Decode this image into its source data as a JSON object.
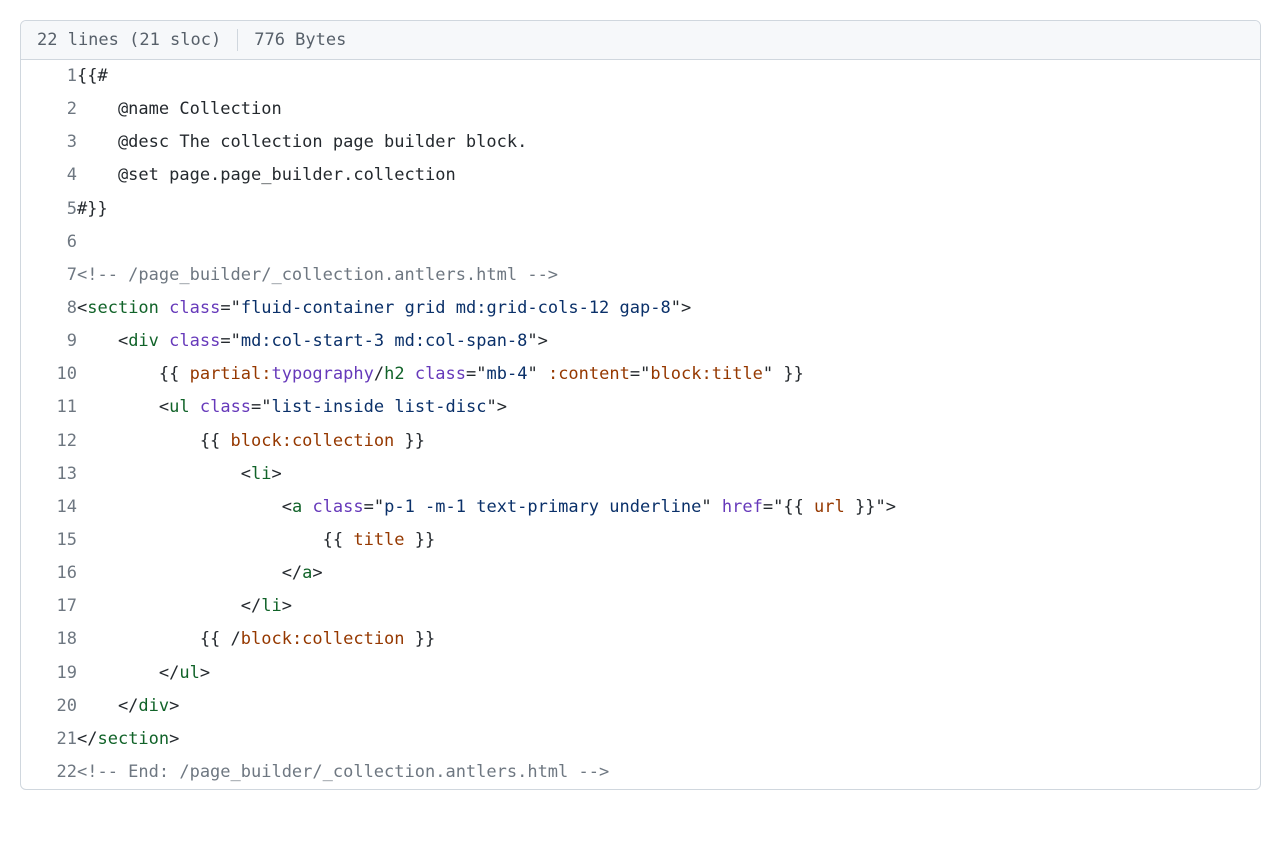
{
  "header": {
    "lines_sloc": "22 lines (21 sloc)",
    "bytes": "776 Bytes"
  },
  "lines": [
    {
      "n": "1",
      "tokens": [
        {
          "t": "{{#",
          "c": "p"
        }
      ]
    },
    {
      "n": "2",
      "tokens": [
        {
          "t": "    @name Collection",
          "c": "p"
        }
      ]
    },
    {
      "n": "3",
      "tokens": [
        {
          "t": "    @desc The collection page builder block.",
          "c": "p"
        }
      ]
    },
    {
      "n": "4",
      "tokens": [
        {
          "t": "    @set page.page_builder.collection",
          "c": "p"
        }
      ]
    },
    {
      "n": "5",
      "tokens": [
        {
          "t": "#}}",
          "c": "p"
        }
      ]
    },
    {
      "n": "6",
      "tokens": [
        {
          "t": "",
          "c": "p"
        }
      ]
    },
    {
      "n": "7",
      "tokens": [
        {
          "t": "<!-- /page_builder/_collection.antlers.html -->",
          "c": "c"
        }
      ]
    },
    {
      "n": "8",
      "tokens": [
        {
          "t": "<",
          "c": "p"
        },
        {
          "t": "section",
          "c": "nt"
        },
        {
          "t": " ",
          "c": "p"
        },
        {
          "t": "class",
          "c": "na"
        },
        {
          "t": "=\"",
          "c": "p"
        },
        {
          "t": "fluid-container grid md:grid-cols-12 gap-8",
          "c": "s"
        },
        {
          "t": "\">",
          "c": "p"
        }
      ]
    },
    {
      "n": "9",
      "tokens": [
        {
          "t": "    <",
          "c": "p"
        },
        {
          "t": "div",
          "c": "nt"
        },
        {
          "t": " ",
          "c": "p"
        },
        {
          "t": "class",
          "c": "na"
        },
        {
          "t": "=\"",
          "c": "p"
        },
        {
          "t": "md:col-start-3 md:col-span-8",
          "c": "s"
        },
        {
          "t": "\">",
          "c": "p"
        }
      ]
    },
    {
      "n": "10",
      "tokens": [
        {
          "t": "        {{ ",
          "c": "p"
        },
        {
          "t": "partial:",
          "c": "kw"
        },
        {
          "t": "typography",
          "c": "na"
        },
        {
          "t": "/",
          "c": "p"
        },
        {
          "t": "h2",
          "c": "nt"
        },
        {
          "t": " ",
          "c": "p"
        },
        {
          "t": "class",
          "c": "na"
        },
        {
          "t": "=\"",
          "c": "p"
        },
        {
          "t": "mb-4",
          "c": "s"
        },
        {
          "t": "\"",
          "c": "p"
        },
        {
          "t": " ",
          "c": "p"
        },
        {
          "t": ":content",
          "c": "kw"
        },
        {
          "t": "=\"",
          "c": "p"
        },
        {
          "t": "block:title",
          "c": "kw"
        },
        {
          "t": "\"",
          "c": "p"
        },
        {
          "t": " }}",
          "c": "p"
        }
      ]
    },
    {
      "n": "11",
      "tokens": [
        {
          "t": "        <",
          "c": "p"
        },
        {
          "t": "ul",
          "c": "nt"
        },
        {
          "t": " ",
          "c": "p"
        },
        {
          "t": "class",
          "c": "na"
        },
        {
          "t": "=\"",
          "c": "p"
        },
        {
          "t": "list-inside list-disc",
          "c": "s"
        },
        {
          "t": "\">",
          "c": "p"
        }
      ]
    },
    {
      "n": "12",
      "tokens": [
        {
          "t": "            {{ ",
          "c": "p"
        },
        {
          "t": "block:collection",
          "c": "kw"
        },
        {
          "t": " }}",
          "c": "p"
        }
      ]
    },
    {
      "n": "13",
      "tokens": [
        {
          "t": "                <",
          "c": "p"
        },
        {
          "t": "li",
          "c": "nt"
        },
        {
          "t": ">",
          "c": "p"
        }
      ]
    },
    {
      "n": "14",
      "tokens": [
        {
          "t": "                    <",
          "c": "p"
        },
        {
          "t": "a",
          "c": "nt"
        },
        {
          "t": " ",
          "c": "p"
        },
        {
          "t": "class",
          "c": "na"
        },
        {
          "t": "=\"",
          "c": "p"
        },
        {
          "t": "p-1 -m-1 text-primary underline",
          "c": "s"
        },
        {
          "t": "\"",
          "c": "p"
        },
        {
          "t": " ",
          "c": "p"
        },
        {
          "t": "href",
          "c": "na"
        },
        {
          "t": "=\"",
          "c": "p"
        },
        {
          "t": "{{ ",
          "c": "p"
        },
        {
          "t": "url",
          "c": "kw"
        },
        {
          "t": " }}",
          "c": "p"
        },
        {
          "t": "\">",
          "c": "p"
        }
      ]
    },
    {
      "n": "15",
      "tokens": [
        {
          "t": "                        {{ ",
          "c": "p"
        },
        {
          "t": "title",
          "c": "kw"
        },
        {
          "t": " }}",
          "c": "p"
        }
      ]
    },
    {
      "n": "16",
      "tokens": [
        {
          "t": "                    </",
          "c": "p"
        },
        {
          "t": "a",
          "c": "nt"
        },
        {
          "t": ">",
          "c": "p"
        }
      ]
    },
    {
      "n": "17",
      "tokens": [
        {
          "t": "                </",
          "c": "p"
        },
        {
          "t": "li",
          "c": "nt"
        },
        {
          "t": ">",
          "c": "p"
        }
      ]
    },
    {
      "n": "18",
      "tokens": [
        {
          "t": "            {{ /",
          "c": "p"
        },
        {
          "t": "block:collection",
          "c": "kw"
        },
        {
          "t": " }}",
          "c": "p"
        }
      ]
    },
    {
      "n": "19",
      "tokens": [
        {
          "t": "        </",
          "c": "p"
        },
        {
          "t": "ul",
          "c": "nt"
        },
        {
          "t": ">",
          "c": "p"
        }
      ]
    },
    {
      "n": "20",
      "tokens": [
        {
          "t": "    </",
          "c": "p"
        },
        {
          "t": "div",
          "c": "nt"
        },
        {
          "t": ">",
          "c": "p"
        }
      ]
    },
    {
      "n": "21",
      "tokens": [
        {
          "t": "</",
          "c": "p"
        },
        {
          "t": "section",
          "c": "nt"
        },
        {
          "t": ">",
          "c": "p"
        }
      ]
    },
    {
      "n": "22",
      "tokens": [
        {
          "t": "<!-- End: /page_builder/_collection.antlers.html -->",
          "c": "c"
        }
      ]
    }
  ]
}
